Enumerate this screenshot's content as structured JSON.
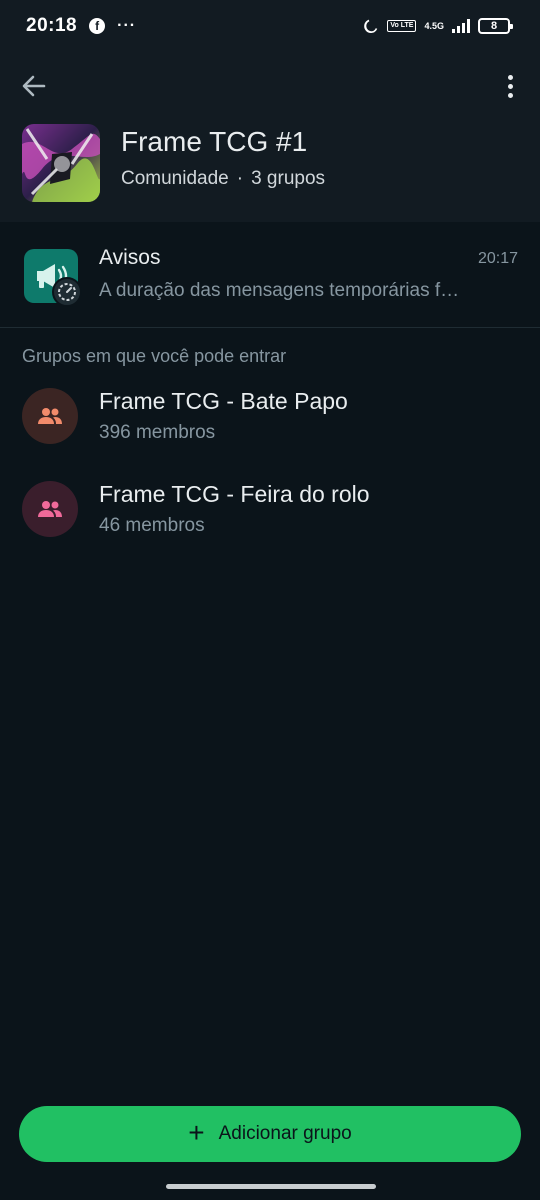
{
  "status_bar": {
    "time": "20:18",
    "network": "4.5G",
    "lte": "Vo LTE",
    "battery": "8",
    "icons": [
      "facebook-icon",
      "more-notifications-icon",
      "moon-icon",
      "signal-icon",
      "battery-icon"
    ]
  },
  "header": {
    "title": "Frame TCG #1",
    "subtitle_type": "Comunidade",
    "subtitle_separator": "·",
    "subtitle_groups": "3 grupos"
  },
  "announcements": {
    "name": "Avisos",
    "time": "20:17",
    "message": "A duração das mensagens temporárias f…",
    "icon_color": "#0e7a6b"
  },
  "section_label": "Grupos em que você pode entrar",
  "groups": [
    {
      "name": "Frame TCG - Bate Papo",
      "members": "396 membros",
      "avatar_bg": "#3b2523",
      "icon_color": "#f28b6b"
    },
    {
      "name": "Frame TCG - Feira do rolo",
      "members": "46 membros",
      "avatar_bg": "#3a1e2c",
      "icon_color": "#f06a9a"
    }
  ],
  "add_button": {
    "icon": "+",
    "label": "Adicionar grupo"
  },
  "colors": {
    "background": "#0b141a",
    "header": "#121b22",
    "accent": "#21c063",
    "text_secondary": "#8696a0"
  }
}
